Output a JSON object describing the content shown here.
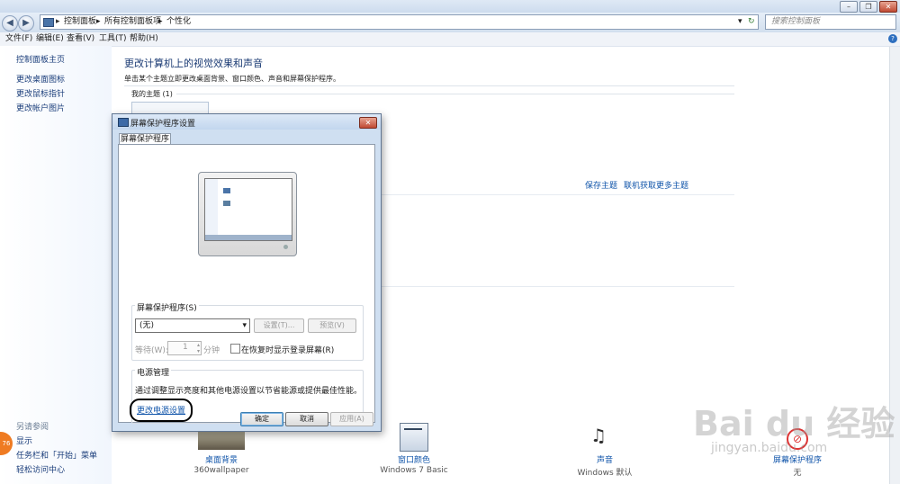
{
  "address": {
    "crumbs": [
      "控制面板",
      "所有控制面板项",
      "个性化"
    ],
    "search_placeholder": "搜索控制面板"
  },
  "menu": [
    "文件(F)",
    "编辑(E)",
    "查看(V)",
    "工具(T)",
    "帮助(H)"
  ],
  "left_nav": {
    "home": "控制面板主页",
    "items": [
      "更改桌面图标",
      "更改鼠标指针",
      "更改帐户图片"
    ],
    "see_also_title": "另请参阅",
    "see_also": [
      "显示",
      "任务栏和「开始」菜单",
      "轻松访问中心"
    ]
  },
  "main": {
    "title": "更改计算机上的视觉效果和声音",
    "subtitle": "单击某个主题立即更改桌面背景、窗口颜色、声音和屏幕保护程序。",
    "my_themes": "我的主题 (1)",
    "save_theme": "保存主题",
    "get_more": "联机获取更多主题"
  },
  "bottom": [
    {
      "icon": "desktop-background-icon",
      "label": "桌面背景",
      "sub": "360wallpaper"
    },
    {
      "icon": "window-color-icon",
      "label": "窗口颜色",
      "sub": "Windows 7 Basic"
    },
    {
      "icon": "sounds-icon",
      "label": "声音",
      "sub": "Windows 默认"
    },
    {
      "icon": "screensaver-icon",
      "label": "屏幕保护程序",
      "sub": "无"
    }
  ],
  "dialog": {
    "title": "屏幕保护程序设置",
    "tab": "屏幕保护程序",
    "saver_group_label": "屏幕保护程序(S)",
    "saver_value": "(无)",
    "settings_btn": "设置(T)...",
    "preview_btn": "预览(V)",
    "wait_label": "等待(W):",
    "wait_value": "1",
    "minutes": "分钟",
    "resume_label": "在恢复时显示登录屏幕(R)",
    "power_title": "电源管理",
    "power_desc": "通过调整显示亮度和其他电源设置以节省能源或提供最佳性能。",
    "power_link": "更改电源设置",
    "ok": "确定",
    "cancel": "取消",
    "apply": "应用(A)"
  },
  "watermark": {
    "badge": "76",
    "brand": "Bai du 经验",
    "url": "jingyan.baidu.com"
  }
}
